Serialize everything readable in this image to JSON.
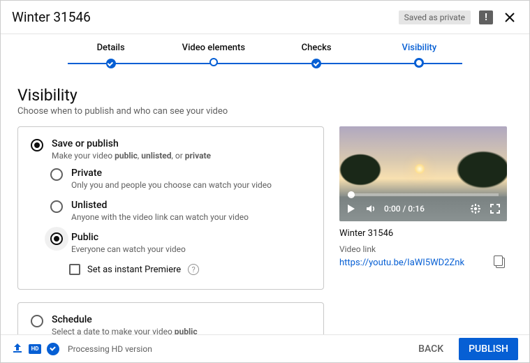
{
  "header": {
    "title": "Winter 31546",
    "saved_badge": "Saved as private"
  },
  "stepper": {
    "s1": "Details",
    "s2": "Video elements",
    "s3": "Checks",
    "s4": "Visibility"
  },
  "section": {
    "title": "Visibility",
    "sub": "Choose when to publish and who can see your video"
  },
  "saveorpublish": {
    "label": "Save or publish",
    "desc_pre": "Make your video ",
    "desc_public": "public",
    "desc_sep1": ", ",
    "desc_unlisted": "unlisted",
    "desc_sep2": ", or ",
    "desc_private": "private"
  },
  "opt_private": {
    "label": "Private",
    "desc": "Only you and people you choose can watch your video"
  },
  "opt_unlisted": {
    "label": "Unlisted",
    "desc": "Anyone with the video link can watch your video"
  },
  "opt_public": {
    "label": "Public",
    "desc": "Everyone can watch your video"
  },
  "premiere": {
    "label": "Set as instant Premiere"
  },
  "schedule": {
    "label": "Schedule",
    "desc_pre": "Select a date to make your video ",
    "desc_bold": "public"
  },
  "preview": {
    "time": "0:00 / 0:16",
    "video_title": "Winter 31546",
    "link_label": "Video link",
    "link_url": "https://youtu.be/IaWI5WD2Znk"
  },
  "footer": {
    "hd": "HD",
    "status": "Processing HD version",
    "back": "BACK",
    "publish": "PUBLISH"
  }
}
